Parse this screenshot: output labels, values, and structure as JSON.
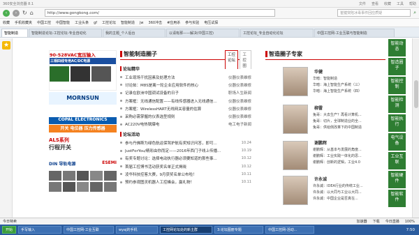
{
  "titlebar": {
    "title": "360安全浏览器 8.1",
    "menu": [
      "文件",
      "查看",
      "收藏",
      "工具",
      "帮助"
    ]
  },
  "address": {
    "url": "http://www.gongkong.com/",
    "search_placeholder": "崔健突陷冰毒事件回应质疑"
  },
  "favorites": [
    "收藏",
    "手机收藏夹",
    "中国工控",
    "中国智能",
    "工业头条",
    "gf",
    "工控论坛",
    "智能制造",
    "jw",
    "360冲击",
    "#应用杀",
    "参与实验",
    "电压试探"
  ],
  "tabs": [
    {
      "label": "智能制造",
      "active": true
    },
    {
      "label": "智能制造论坛-工控论坛-专业自动化"
    },
    {
      "label": "我的主题_个人后台"
    },
    {
      "label": "以请有那——解决(中国工控)"
    },
    {
      "label": "工控论坛_专业自动化论坛"
    },
    {
      "label": "中国工控网-工业互联与智能制造"
    }
  ],
  "ads": {
    "ad1": {
      "line1": "90-528VAC宽压输入",
      "line2": "三相四线专用AC/DC电源"
    },
    "ad2": {
      "brand": "MORNSUN",
      "tag": "COPAL ELECTRONICS",
      "tag2": "开关 电位器 压力传感器"
    },
    "ad3": {
      "line1": "ALS系列",
      "line2": "行程开关"
    },
    "ad4": {
      "line1": "DIN 导轨电源",
      "brand": "ESEMI"
    }
  },
  "forum": {
    "title": "智能制造圈子",
    "tabs": [
      "工控论坛",
      "工控圈"
    ],
    "section1": "论坛精华",
    "posts1": [
      {
        "text": "工业现场干扰因素及处理方法",
        "src": "仪器仪表维修"
      },
      {
        "text": "讨论帖：M8S是离一轮企业应用软件的核心",
        "src": "仪器仪表维修"
      },
      {
        "text": "记录在欧洲中国调试设备的日子",
        "src": "职场人生新闻"
      },
      {
        "text": "方案框：无线通信配置——有线传感器进入无线通信...",
        "src": "仪器仪表维修"
      },
      {
        "text": "方案框：WirelessHART无线网关容量的估算",
        "src": "仪器仪表维修"
      },
      {
        "text": "采购必需掌握的仪表选型规则",
        "src": "仪器仪表维修"
      },
      {
        "text": "AC220V电热锅爆电",
        "src": "电工电子新闻"
      }
    ],
    "section2": "论坛活动",
    "posts2": [
      {
        "text": "参与丹佛斯为绿色航运保驾护航有奖知识问答，即可...",
        "date": "10.24"
      },
      {
        "text": "JustForYou/精彩由你而定——2016年西门子线上传播...",
        "date": "10.19"
      },
      {
        "text": "有奖专题讨论：选择电动执行器必须要知道的那些事...",
        "date": "10.12"
      },
      {
        "text": "首届工控博书活动获奖名单正式揭晓",
        "date": "10.12"
      },
      {
        "text": "凌华科技控客大赛，9月获奖名单公布啦！",
        "date": "10.11"
      },
      {
        "text": "预约参观图灵机器人工控峰会，赢礼物！",
        "date": "10.11"
      }
    ]
  },
  "experts": {
    "title": "智造圈子专家",
    "list": [
      {
        "name": "华健",
        "lines": [
          "华暗：智能制造",
          "华暗：海上智能生产系统（三）",
          "华暗：海上智能生产系统（四）"
        ]
      },
      {
        "name": "柳雷",
        "lines": [
          "兔哥：大去生产？再看计算机...",
          "兔哥：切片，全球制造业的全...",
          "兔哥：供给侧改革下的中国制造"
        ]
      },
      {
        "name": "谢鹏辉",
        "lines": [
          "谢鹏辉：从基本与发展的角度...",
          "谢鹏辉：工业实践一体化的思...",
          "谢鹏辉：创新的逻辑，工业4.0"
        ]
      },
      {
        "name": "许永诚",
        "lines": [
          "许永诚：IDEA行业的传统工业...",
          "许永诚：以大同与工业以大同...",
          "许永诚：中国企业是否真在..."
        ]
      }
    ]
  },
  "rightnav": [
    "智能动态",
    "智造圈子",
    "智能控制",
    "智能检测",
    "智能执行",
    "电气设备",
    "工业互联",
    "智能硬件",
    "智能软件"
  ],
  "statusbar": {
    "left": "今日特卖",
    "zoom": "100%",
    "items": [
      "加速器",
      "下载",
      "今日直播"
    ]
  },
  "taskbar": {
    "start": "开始",
    "items": [
      "手写输入",
      "中国工控网-工业互联",
      "wyaj的手机",
      "工控网论坛处的新主群",
      "3:论坛图册专题",
      "中国工控网-活动..."
    ],
    "clock": "7:50"
  }
}
